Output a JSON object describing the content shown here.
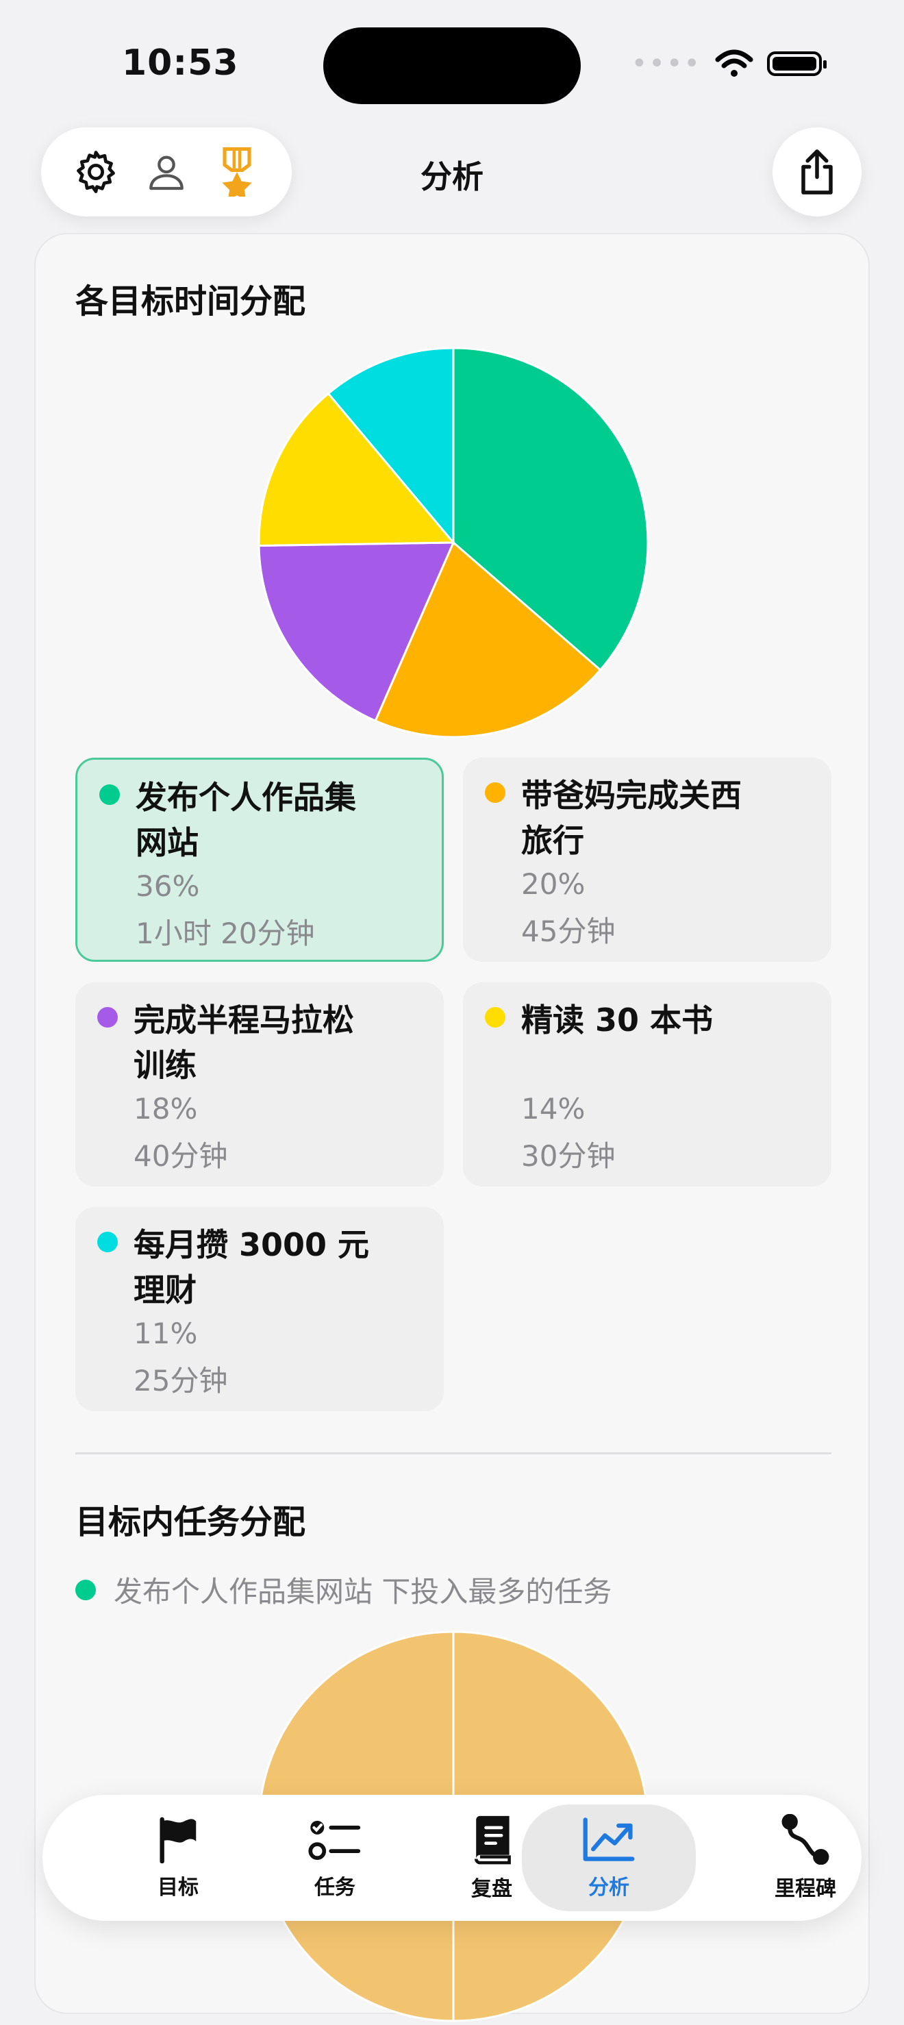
{
  "status": {
    "time": "10:53"
  },
  "header": {
    "title": "分析"
  },
  "section1": {
    "title": "各目标时间分配"
  },
  "goals": [
    {
      "name": "发布个人作品集网站",
      "name_l1": "发布个人作品集",
      "name_l2": "网站",
      "pct": "36%",
      "time": "1小时 20分钟",
      "value": 36,
      "color": "#00cc90",
      "selected": true
    },
    {
      "name": "带爸妈完成关西旅行",
      "name_l1": "带爸妈完成关西",
      "name_l2": "旅行",
      "pct": "20%",
      "time": "45分钟",
      "value": 20,
      "color": "#ffb200",
      "selected": false
    },
    {
      "name": "完成半程马拉松训练",
      "name_l1": "完成半程马拉松",
      "name_l2": "训练",
      "pct": "18%",
      "time": "40分钟",
      "value": 18,
      "color": "#a65ae8",
      "selected": false
    },
    {
      "name": "精读 30 本书",
      "name_l1": "精读 30 本书",
      "name_l2": "",
      "pct": "14%",
      "time": "30分钟",
      "value": 14,
      "color": "#ffdd00",
      "selected": false
    },
    {
      "name": "每月攒 3000 元理财",
      "name_l1": "每月攒 3000 元",
      "name_l2": "理财",
      "pct": "11%",
      "time": "25分钟",
      "value": 11,
      "color": "#00dde0",
      "selected": false
    }
  ],
  "chart_data": [
    {
      "type": "pie",
      "categories": [
        "发布个人作品集网站",
        "带爸妈完成关西旅行",
        "完成半程马拉松训练",
        "精读 30 本书",
        "每月攒 3000 元理财"
      ],
      "values": [
        36,
        20,
        18,
        14,
        11
      ],
      "colors": [
        "#00cc90",
        "#ffb200",
        "#a65ae8",
        "#ffdd00",
        "#00dde0"
      ]
    },
    {
      "type": "pie",
      "categories": [],
      "values": [
        50,
        50
      ],
      "colors": [
        "#f3c46f",
        "#f3c46f"
      ]
    }
  ],
  "section2": {
    "title": "目标内任务分配",
    "subtitle": "发布个人作品集网站 下投入最多的任务",
    "dot_color": "#00cc90"
  },
  "tabs": [
    {
      "label": "目标",
      "icon": "flag-icon"
    },
    {
      "label": "任务",
      "icon": "checklist-icon"
    },
    {
      "label": "复盘",
      "icon": "book-icon"
    },
    {
      "label": "分析",
      "icon": "chart-icon",
      "active": true
    },
    {
      "label": "里程碑",
      "icon": "route-icon"
    }
  ],
  "colors": {
    "accent": "#1f7ae0",
    "medal": "#f2a51a"
  }
}
